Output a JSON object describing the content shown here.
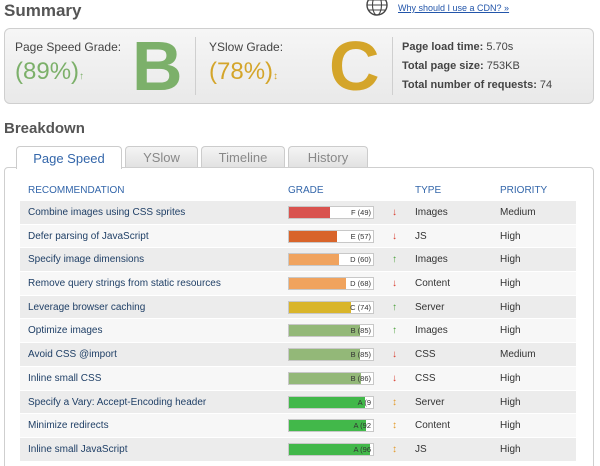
{
  "summary": {
    "title": "Summary",
    "cdn_link": "Why should I use a CDN? »",
    "pagespeed": {
      "label": "Page Speed Grade:",
      "percent": "(89%)",
      "arrow": "↑",
      "letter": "B",
      "color": "#7cb06a"
    },
    "yslow": {
      "label": "YSlow Grade:",
      "percent": "(78%)",
      "arrow": "↕",
      "letter": "C",
      "color": "#d4a52a"
    },
    "stats": [
      {
        "label": "Page load time:",
        "value": "5.70s"
      },
      {
        "label": "Total page size:",
        "value": "753KB"
      },
      {
        "label": "Total number of requests:",
        "value": "74"
      }
    ]
  },
  "breakdown": {
    "title": "Breakdown",
    "tabs": [
      {
        "label": "Page Speed",
        "active": true
      },
      {
        "label": "YSlow",
        "active": false
      },
      {
        "label": "Timeline",
        "active": false
      },
      {
        "label": "History",
        "active": false
      }
    ],
    "columns": {
      "recommendation": "RECOMMENDATION",
      "grade": "GRADE",
      "type": "TYPE",
      "priority": "PRIORITY"
    },
    "rows": [
      {
        "recommendation": "Combine images using CSS sprites",
        "grade": "F (49)",
        "score": 49,
        "arrow": "↓",
        "type": "Images",
        "priority": "Medium"
      },
      {
        "recommendation": "Defer parsing of JavaScript",
        "grade": "E (57)",
        "score": 57,
        "arrow": "↓",
        "type": "JS",
        "priority": "High"
      },
      {
        "recommendation": "Specify image dimensions",
        "grade": "D (60)",
        "score": 60,
        "arrow": "↑",
        "type": "Images",
        "priority": "High"
      },
      {
        "recommendation": "Remove query strings from static resources",
        "grade": "D (68)",
        "score": 68,
        "arrow": "↓",
        "type": "Content",
        "priority": "High"
      },
      {
        "recommendation": "Leverage browser caching",
        "grade": "C (74)",
        "score": 74,
        "arrow": "↑",
        "type": "Server",
        "priority": "High"
      },
      {
        "recommendation": "Optimize images",
        "grade": "B (85)",
        "score": 85,
        "arrow": "↑",
        "type": "Images",
        "priority": "High"
      },
      {
        "recommendation": "Avoid CSS @import",
        "grade": "B (85)",
        "score": 85,
        "arrow": "↓",
        "type": "CSS",
        "priority": "Medium"
      },
      {
        "recommendation": "Inline small CSS",
        "grade": "B (86)",
        "score": 86,
        "arrow": "↓",
        "type": "CSS",
        "priority": "High"
      },
      {
        "recommendation": "Specify a Vary: Accept-Encoding header",
        "grade": "A (9",
        "score": 90,
        "arrow": "↕",
        "type": "Server",
        "priority": "High"
      },
      {
        "recommendation": "Minimize redirects",
        "grade": "A (92",
        "score": 92,
        "arrow": "↕",
        "type": "Content",
        "priority": "High"
      },
      {
        "recommendation": "Inline small JavaScript",
        "grade": "A (96",
        "score": 96,
        "arrow": "↕",
        "type": "JS",
        "priority": "High"
      }
    ],
    "colors": {
      "F": "#d9534f",
      "E": "#d8642a",
      "D": "#f0a35e",
      "C": "#d9b52a",
      "B": "#93b878",
      "A": "#42b84a"
    },
    "arrow_colors": {
      "↓": "#d83a2a",
      "↑": "#4aa03a",
      "↕": "#e39a2a"
    }
  }
}
